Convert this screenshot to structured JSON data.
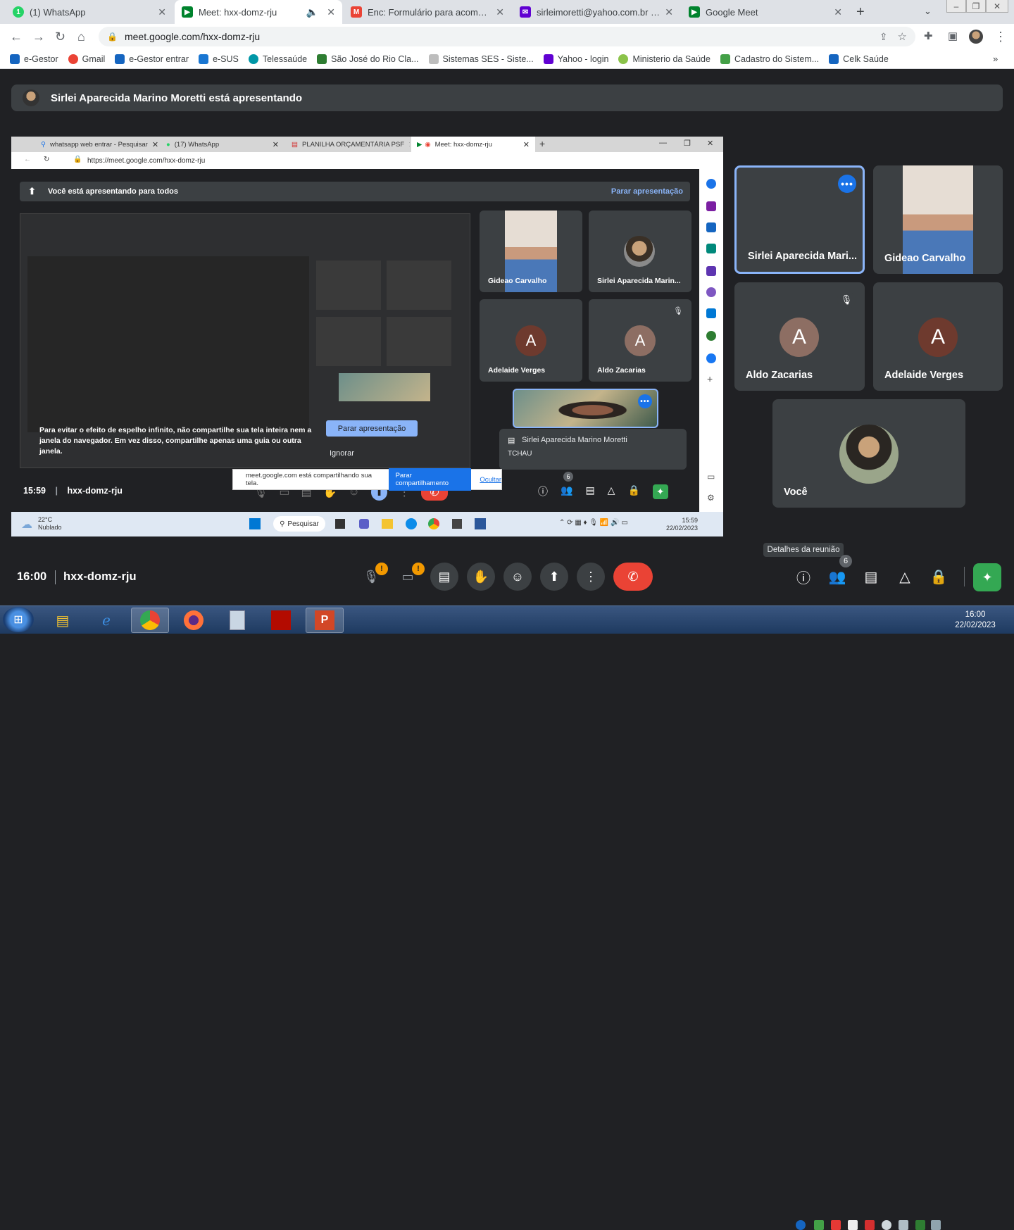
{
  "browser": {
    "tabs": [
      {
        "title": "(1) WhatsApp",
        "color": "#25d366",
        "glyph": "1"
      },
      {
        "title": "Meet: hxx-domz-rju",
        "color": "#00832d",
        "glyph": "M",
        "active": true
      },
      {
        "title": "Enc: Formulário para acompanha",
        "color": "#ea4335",
        "glyph": "M"
      },
      {
        "title": "sirleimoretti@yahoo.com.br - Yal",
        "color": "#6001d2",
        "glyph": "✉"
      },
      {
        "title": "Google Meet",
        "color": "#00832d",
        "glyph": "M"
      }
    ],
    "url": "meet.google.com/hxx-domz-rju",
    "bookmarks": [
      {
        "label": "e-Gestor",
        "color": "#1565c0"
      },
      {
        "label": "Gmail",
        "color": "#ea4335"
      },
      {
        "label": "e-Gestor entrar",
        "color": "#1565c0"
      },
      {
        "label": "e-SUS",
        "color": "#1976d2"
      },
      {
        "label": "Telessaúde",
        "color": "#0097a7"
      },
      {
        "label": "São José do Rio Cla...",
        "color": "#2e7d32"
      },
      {
        "label": "Sistemas SES - Siste...",
        "color": "#9e9e9e"
      },
      {
        "label": "Yahoo - login",
        "color": "#6001d2"
      },
      {
        "label": "Ministerio da Saúde",
        "color": "#8bc34a"
      },
      {
        "label": "Cadastro do Sistem...",
        "color": "#43a047"
      },
      {
        "label": "Celk Saúde",
        "color": "#1565c0"
      }
    ]
  },
  "meet": {
    "presenter_banner": "Sirlei Aparecida Marino Moretti está apresentando",
    "time": "16:00",
    "code": "hxx-domz-rju",
    "tooltip": "Detalhes da reunião",
    "people_count": "6",
    "mic_badge": "!",
    "cam_badge": "!",
    "tiles": [
      {
        "name": "Sirlei Aparecida Mari..."
      },
      {
        "name": "Gideao Carvalho"
      },
      {
        "name": "Aldo Zacarias",
        "letter": "A"
      },
      {
        "name": "Adelaide Verges",
        "letter": "A"
      },
      {
        "name": "Você"
      }
    ]
  },
  "shared": {
    "tabs": [
      {
        "title": "whatsapp web entrar - Pesquisar"
      },
      {
        "title": "(17) WhatsApp"
      },
      {
        "title": "PLANILHA ORÇAMENTÁRIA PSF"
      },
      {
        "title": "Meet: hxx-domz-rju"
      }
    ],
    "url": "https://meet.google.com/hxx-domz-rju",
    "banner": "Você está apresentando para todos",
    "stop_link": "Parar apresentação",
    "warning": "Para evitar o efeito de espelho infinito, não compartilhe sua tela inteira nem a janela do navegador. Em vez disso, compartilhe apenas uma guia ou outra janela.",
    "stop_button": "Parar apresentação",
    "ignore": "Ignorar",
    "tiles": [
      {
        "name": "Gideao Carvalho"
      },
      {
        "name": "Sirlei Aparecida Marin..."
      },
      {
        "name": "Adelaide Verges",
        "letter": "A"
      },
      {
        "name": "Aldo Zacarias",
        "letter": "A"
      }
    ],
    "chat_name": "Sirlei Aparecida Marino Moretti",
    "chat_msg": "TCHAU",
    "time": "15:59",
    "code": "hxx-domz-rju",
    "people_count": "6",
    "sharing_text": "meet.google.com está compartilhando sua tela.",
    "stop_sharing": "Parar compartilhamento",
    "hide": "Ocultar",
    "weather_temp": "22°C",
    "weather_desc": "Nublado",
    "search": "Pesquisar",
    "clock_time": "15:59",
    "clock_date": "22/02/2023"
  },
  "os": {
    "clock_time": "16:00",
    "clock_date": "22/02/2023"
  }
}
